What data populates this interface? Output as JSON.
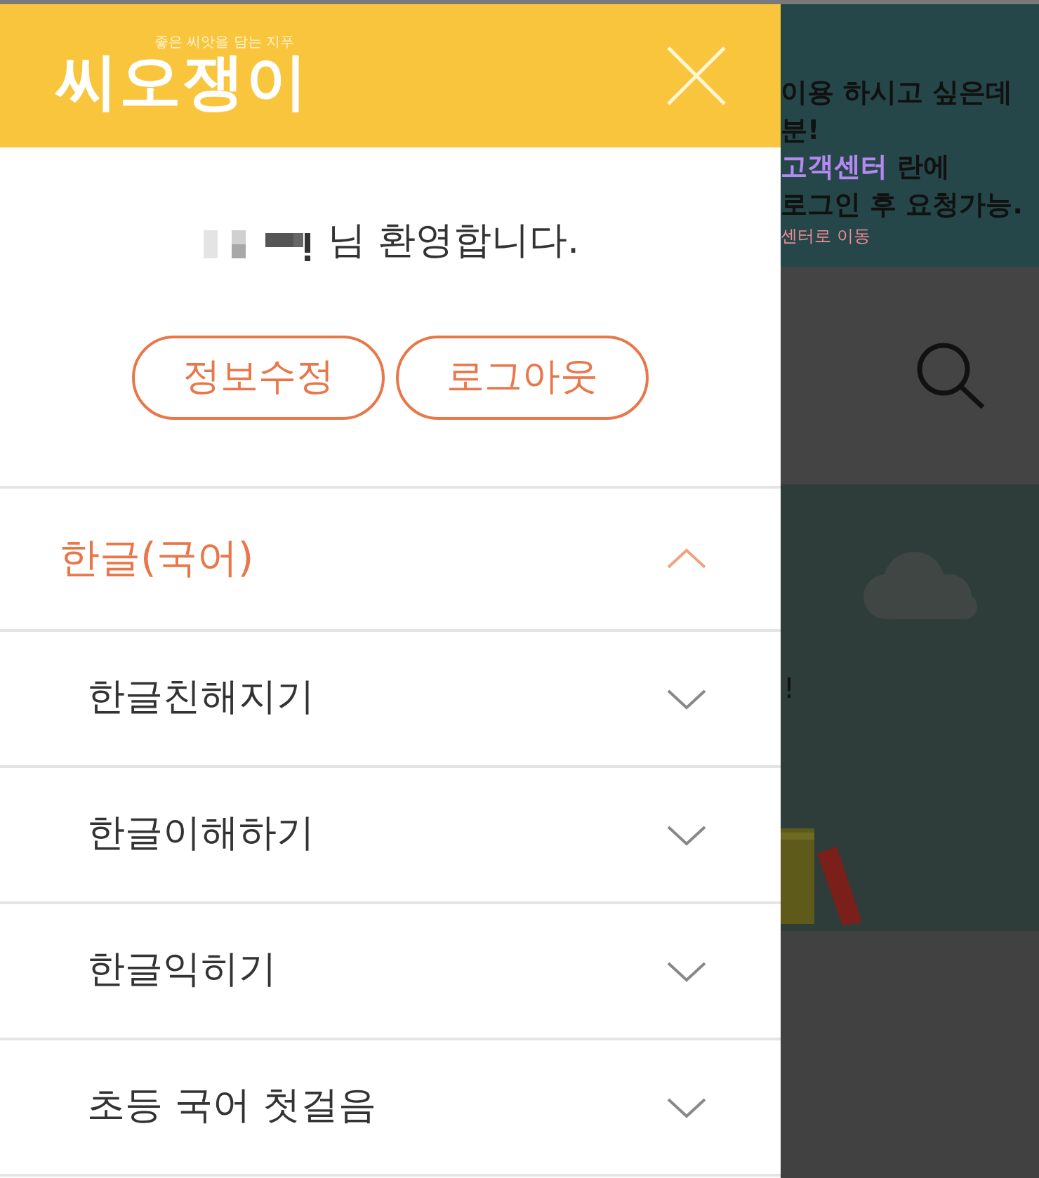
{
  "drawer": {
    "logo": {
      "tagline": "좋은 씨앗을 담는 지푸",
      "name": "씨오쟁이"
    },
    "welcome": "님 환영합니다.",
    "buttons": [
      "정보수정",
      "로그아웃"
    ],
    "menu": [
      {
        "label": "한글(국어)",
        "expanded": true,
        "children": [
          {
            "label": "한글친해지기",
            "expanded": false
          },
          {
            "label": "한글이해하기",
            "expanded": false
          },
          {
            "label": "한글익히기",
            "expanded": false
          },
          {
            "label": "초등 국어 첫걸음",
            "expanded": false
          }
        ]
      }
    ]
  },
  "background_page": {
    "notice": [
      "이용 하시고 싶은데",
      "분!",
      "**고객센터** 란에",
      "로그인 후 요청가능."
    ],
    "notice_link": "센터로 이동",
    "banner_text": "!"
  }
}
